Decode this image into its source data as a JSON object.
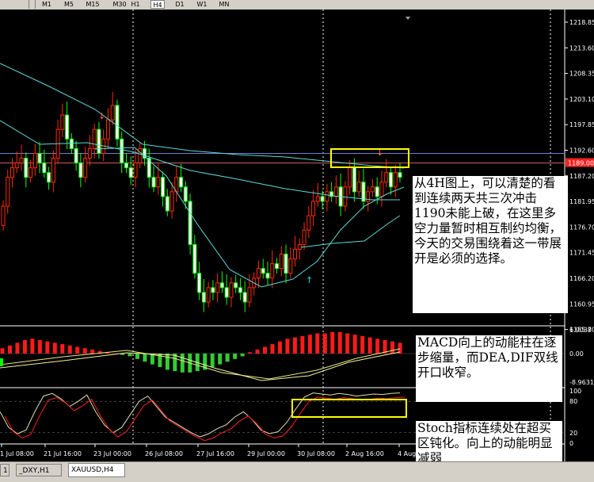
{
  "toolbar": {
    "timeframes": [
      "M1",
      "M5",
      "M15",
      "M30",
      "H1",
      "H4",
      "D1",
      "W1",
      "MN"
    ],
    "active": "H4"
  },
  "tabs": [
    {
      "label": "1",
      "active": false
    },
    {
      "label": "_DXY,H1",
      "active": false
    },
    {
      "label": "XAUUSD,H4",
      "active": true
    }
  ],
  "price_axis": {
    "labels": [
      "1218.85",
      "1213.60",
      "1208.35",
      "1203.10",
      "1197.85",
      "1192.60",
      "1187.20",
      "1181.95",
      "1176.70",
      "1171.45",
      "1166.20",
      "1160.95",
      "1155.70"
    ],
    "current_price": "1189.00"
  },
  "macd_axis": {
    "top": "6.9038",
    "zero": "0.00",
    "bottom": "-8.9631"
  },
  "stoch_axis": {
    "labels": [
      "100",
      "80",
      "20",
      "0"
    ]
  },
  "time_axis": [
    "1 Jul 08:00",
    "21 Jul 16:00",
    "23 Jul 00:00",
    "26 Jul 08:00",
    "27 Jul 16:00",
    "29 Jul 00:00",
    "30 Jul 08:00",
    "2 Aug 16:00",
    "4 Aug"
  ],
  "notes": {
    "price": "从4H图上，可以清楚的看到连续两天共三次冲击1190未能上破，在这里多空力量暂时相互制约均衡，今天的交易围绕着这一带展开是必须的选择。",
    "macd": "MACD向上的动能柱在逐步缩量，而DEA,DIF双线开口收窄。",
    "stoch": "Stoch指标连续处在超买区钝化。向上的动能明显减弱"
  },
  "colors": {
    "bull": "#ffffff",
    "bear": "#ff2a00",
    "doji": "#00ff00",
    "ma": "#5fd7d7",
    "macd_pos": "#ff1a1a",
    "macd_neg": "#33cc33",
    "signal": "#e6e685",
    "stoch_main": "#e0e0b0",
    "stoch_signal": "#ff2020",
    "highlight": "#ffff00"
  }
}
